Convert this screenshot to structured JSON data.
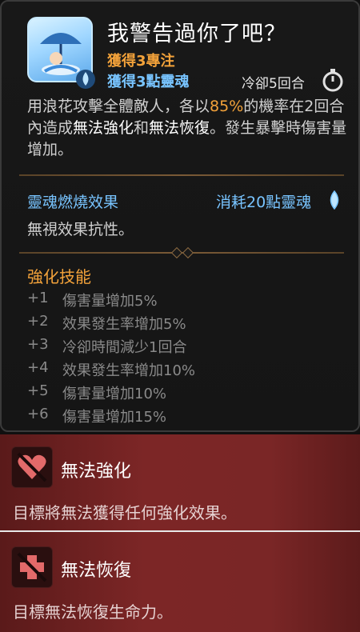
{
  "skill": {
    "title": "我警告過你了吧？",
    "gain_focus": "獲得3專注",
    "gain_soul": "獲得3點靈魂",
    "cooldown": "冷卻5回合",
    "desc_part1": "用浪花攻擊全體敵人，各以",
    "desc_pct": "85%",
    "desc_part2": "的機率在2回合內造成",
    "desc_kw1": "無法強化",
    "desc_and": "和",
    "desc_kw2": "無法恢復",
    "desc_part3": "。發生暴擊時傷害量增加。"
  },
  "soul_burn": {
    "title": "靈魂燃燒效果",
    "cost": "消耗20點靈魂",
    "text": "無視效果抗性。"
  },
  "enhance": {
    "title": "強化技能",
    "items": [
      {
        "lv": "+1",
        "text": "傷害量增加5%"
      },
      {
        "lv": "+2",
        "text": "效果發生率增加5%"
      },
      {
        "lv": "+3",
        "text": "冷卻時間減少1回合"
      },
      {
        "lv": "+4",
        "text": "效果發生率增加10%"
      },
      {
        "lv": "+5",
        "text": "傷害量增加10%"
      },
      {
        "lv": "+6",
        "text": "傷害量增加15%"
      }
    ]
  },
  "effects": [
    {
      "name": "無法強化",
      "text": "目標將無法獲得任何強化效果。",
      "icon": "broken-heart-icon"
    },
    {
      "name": "無法恢復",
      "text": "目標無法恢復生命力。",
      "icon": "no-heal-icon"
    }
  ],
  "colors": {
    "accent_orange": "#f3a23a",
    "accent_blue": "#78c4ff",
    "debuff_red": "#7c2626"
  }
}
